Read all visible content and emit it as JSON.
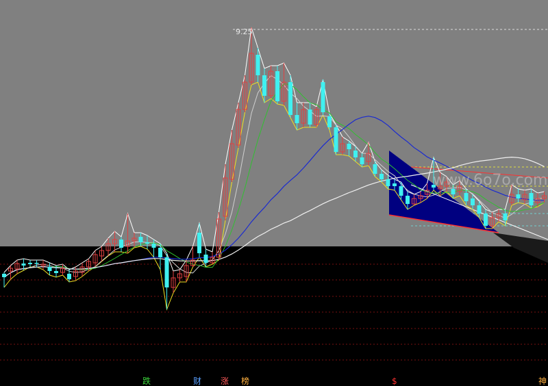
{
  "chart_data": {
    "type": "candlestick",
    "peak_label": "9.25",
    "watermark": "www.6o7o.com",
    "candles": [
      {
        "o": 400,
        "c": 405,
        "h": 398,
        "l": 420
      },
      {
        "o": 396,
        "c": 392,
        "h": 388,
        "l": 408
      },
      {
        "o": 393,
        "c": 385,
        "h": 380,
        "l": 400
      },
      {
        "o": 385,
        "c": 388,
        "h": 378,
        "l": 395
      },
      {
        "o": 384,
        "c": 386,
        "h": 380,
        "l": 390
      },
      {
        "o": 384,
        "c": 385,
        "h": 380,
        "l": 390
      },
      {
        "o": 388,
        "c": 386,
        "h": 380,
        "l": 394
      },
      {
        "o": 390,
        "c": 396,
        "h": 384,
        "l": 402
      },
      {
        "o": 396,
        "c": 399,
        "h": 388,
        "l": 405
      },
      {
        "o": 398,
        "c": 392,
        "h": 386,
        "l": 402
      },
      {
        "o": 400,
        "c": 408,
        "h": 394,
        "l": 412
      },
      {
        "o": 404,
        "c": 396,
        "h": 390,
        "l": 410
      },
      {
        "o": 398,
        "c": 390,
        "h": 384,
        "l": 404
      },
      {
        "o": 390,
        "c": 382,
        "h": 378,
        "l": 396
      },
      {
        "o": 384,
        "c": 372,
        "h": 366,
        "l": 390
      },
      {
        "o": 374,
        "c": 366,
        "h": 360,
        "l": 382
      },
      {
        "o": 366,
        "c": 356,
        "h": 348,
        "l": 374
      },
      {
        "o": 356,
        "c": 350,
        "h": 338,
        "l": 368
      },
      {
        "o": 350,
        "c": 362,
        "h": 346,
        "l": 368
      },
      {
        "o": 360,
        "c": 352,
        "h": 312,
        "l": 370
      },
      {
        "o": 352,
        "c": 348,
        "h": 340,
        "l": 362
      },
      {
        "o": 346,
        "c": 354,
        "h": 340,
        "l": 360
      },
      {
        "o": 354,
        "c": 356,
        "h": 344,
        "l": 364
      },
      {
        "o": 356,
        "c": 362,
        "h": 350,
        "l": 376
      },
      {
        "o": 362,
        "c": 376,
        "h": 356,
        "l": 394
      },
      {
        "o": 376,
        "c": 420,
        "h": 370,
        "l": 452
      },
      {
        "o": 420,
        "c": 406,
        "h": 396,
        "l": 428
      },
      {
        "o": 406,
        "c": 400,
        "h": 394,
        "l": 412
      },
      {
        "o": 404,
        "c": 388,
        "h": 380,
        "l": 412
      },
      {
        "o": 388,
        "c": 380,
        "h": 360,
        "l": 390
      },
      {
        "o": 340,
        "c": 370,
        "h": 326,
        "l": 376
      },
      {
        "o": 372,
        "c": 384,
        "h": 364,
        "l": 390
      },
      {
        "o": 384,
        "c": 376,
        "h": 368,
        "l": 386
      },
      {
        "o": 376,
        "c": 320,
        "h": 310,
        "l": 380
      },
      {
        "o": 316,
        "c": 260,
        "h": 240,
        "l": 322
      },
      {
        "o": 262,
        "c": 210,
        "h": 190,
        "l": 266
      },
      {
        "o": 212,
        "c": 160,
        "h": 150,
        "l": 216
      },
      {
        "o": 160,
        "c": 120,
        "h": 110,
        "l": 164
      },
      {
        "o": 120,
        "c": 78,
        "h": 40,
        "l": 124
      },
      {
        "o": 80,
        "c": 110,
        "h": 70,
        "l": 120
      },
      {
        "o": 110,
        "c": 140,
        "h": 100,
        "l": 150
      },
      {
        "o": 140,
        "c": 104,
        "h": 96,
        "l": 144
      },
      {
        "o": 104,
        "c": 148,
        "h": 96,
        "l": 152
      },
      {
        "o": 148,
        "c": 120,
        "h": 92,
        "l": 154
      },
      {
        "o": 120,
        "c": 168,
        "h": 110,
        "l": 172
      },
      {
        "o": 168,
        "c": 180,
        "h": 150,
        "l": 190
      },
      {
        "o": 180,
        "c": 160,
        "h": 150,
        "l": 186
      },
      {
        "o": 160,
        "c": 182,
        "h": 150,
        "l": 186
      },
      {
        "o": 182,
        "c": 160,
        "h": 156,
        "l": 186
      },
      {
        "o": 120,
        "c": 164,
        "h": 116,
        "l": 168
      },
      {
        "o": 170,
        "c": 186,
        "h": 166,
        "l": 190
      },
      {
        "o": 186,
        "c": 222,
        "h": 182,
        "l": 226
      },
      {
        "o": 222,
        "c": 210,
        "h": 200,
        "l": 226
      },
      {
        "o": 210,
        "c": 218,
        "h": 206,
        "l": 228
      },
      {
        "o": 220,
        "c": 230,
        "h": 214,
        "l": 236
      },
      {
        "o": 230,
        "c": 240,
        "h": 224,
        "l": 244
      },
      {
        "o": 236,
        "c": 224,
        "h": 208,
        "l": 242
      },
      {
        "o": 240,
        "c": 254,
        "h": 236,
        "l": 258
      },
      {
        "o": 254,
        "c": 262,
        "h": 248,
        "l": 266
      },
      {
        "o": 262,
        "c": 272,
        "h": 256,
        "l": 276
      },
      {
        "o": 268,
        "c": 272,
        "h": 262,
        "l": 278
      },
      {
        "o": 272,
        "c": 286,
        "h": 266,
        "l": 292
      },
      {
        "o": 286,
        "c": 298,
        "h": 280,
        "l": 306
      },
      {
        "o": 298,
        "c": 290,
        "h": 284,
        "l": 300
      },
      {
        "o": 290,
        "c": 286,
        "h": 280,
        "l": 296
      },
      {
        "o": 284,
        "c": 278,
        "h": 268,
        "l": 290
      },
      {
        "o": 270,
        "c": 274,
        "h": 230,
        "l": 278
      },
      {
        "o": 276,
        "c": 272,
        "h": 252,
        "l": 286
      },
      {
        "o": 272,
        "c": 266,
        "h": 258,
        "l": 280
      },
      {
        "o": 276,
        "c": 284,
        "h": 270,
        "l": 290
      },
      {
        "o": 280,
        "c": 272,
        "h": 264,
        "l": 286
      },
      {
        "o": 282,
        "c": 294,
        "h": 276,
        "l": 300
      },
      {
        "o": 290,
        "c": 300,
        "h": 284,
        "l": 306
      },
      {
        "o": 300,
        "c": 312,
        "h": 294,
        "l": 318
      },
      {
        "o": 312,
        "c": 330,
        "h": 306,
        "l": 334
      },
      {
        "o": 330,
        "c": 318,
        "h": 310,
        "l": 334
      },
      {
        "o": 318,
        "c": 312,
        "h": 306,
        "l": 324
      },
      {
        "o": 312,
        "c": 322,
        "h": 306,
        "l": 330
      },
      {
        "o": 296,
        "c": 284,
        "h": 270,
        "l": 300
      },
      {
        "o": 284,
        "c": 290,
        "h": 276,
        "l": 296
      },
      {
        "o": 292,
        "c": 284,
        "h": 278,
        "l": 298
      },
      {
        "o": 282,
        "c": 300,
        "h": 276,
        "l": 304
      },
      {
        "o": 296,
        "c": 290,
        "h": 282,
        "l": 302
      },
      {
        "o": 290,
        "c": 286,
        "h": 280,
        "l": 296
      }
    ],
    "bottom_tags": [
      {
        "text": "跌",
        "color": "#3cd43c"
      },
      {
        "text": "财",
        "color": "#5aa0ff"
      },
      {
        "text": "涨",
        "color": "#ff5a5a"
      },
      {
        "text": "榜",
        "color": "#ffb040"
      },
      {
        "text": "$",
        "color": "#ff3030"
      },
      {
        "text": "神",
        "color": "#ffb040"
      }
    ]
  }
}
